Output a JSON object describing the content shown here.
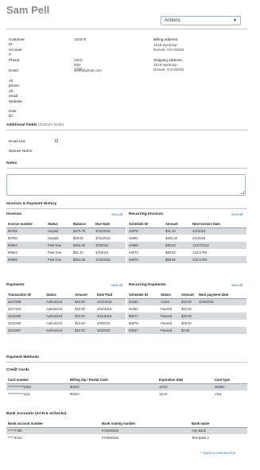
{
  "customer": {
    "name": "Sam Pell",
    "actions_label": "Actions",
    "fields": [
      {
        "label": "Customer ID:",
        "value": "150379"
      },
      {
        "label": "Account #:",
        "value": ""
      },
      {
        "label": "Phone:",
        "value": "(303) 555-1212"
      },
      {
        "label": "Email:",
        "value": "spell@gmail.com"
      },
      {
        "label": "Alt phone:",
        "value": ""
      },
      {
        "label": "Alt email:",
        "value": ""
      },
      {
        "label": "Website:",
        "value": ""
      },
      {
        "label": "User ID:",
        "value": ""
      }
    ],
    "billing": {
      "label": "Billing address:",
      "line1": "1515 wynkoop",
      "line2": "Denver, CO 80202"
    },
    "shipping": {
      "label": "Shipping address:",
      "line1": "1515 wynkoop",
      "line2": "Denver, CO 80202"
    }
  },
  "additional": {
    "title": "Additional Fields",
    "subtitle": "(Custom fields)",
    "fields": [
      {
        "label": "Email List:"
      },
      {
        "label": "Spouse Name:"
      }
    ]
  },
  "notes": {
    "title": "Notes"
  },
  "history": {
    "title": "Invoices & Payment History",
    "view_all": "view all",
    "invoices": {
      "title": "Invoices",
      "columns": [
        "Invoice number",
        "Status",
        "Balance",
        "Due Date"
      ],
      "rows": [
        [
          "89758",
          "Unpaid",
          "$273.78",
          "3/31/2015"
        ],
        [
          "89759",
          "Unpaid",
          "$25.00",
          "3/31/2015"
        ],
        [
          "89663",
          "Past Due",
          "$304.20",
          "3/3/2015"
        ],
        [
          "89664",
          "Past Due",
          "$51.20",
          "3/3/2015"
        ],
        [
          "89565",
          "Past Due",
          "$304.62",
          "1/31/2015"
        ]
      ]
    },
    "recurring_invoices": {
      "title": "Recurring Invoices",
      "columns": [
        "Schedule ID",
        "Amount",
        "Next Invoice Date"
      ],
      "rows": [
        [
          "44978",
          "$31.20",
          "4/1/2015"
        ],
        [
          "44991",
          "$304.20",
          "4/1/2015"
        ],
        [
          "44966",
          "$30.00",
          "11/27/2012"
        ],
        [
          "44973",
          "$88.62",
          "1/11/1753"
        ],
        [
          "44976",
          "$88.62",
          "1/11/1753"
        ]
      ]
    },
    "payments": {
      "title": "Payments",
      "columns": [
        "Transaction ID",
        "Status",
        "Amount",
        "Date Paid"
      ],
      "rows": [
        [
          "3217599",
          "Authorized",
          "$10.00",
          "3/12/2015"
        ],
        [
          "3217224",
          "Authorized",
          "$10.00",
          "3/11/2015"
        ],
        [
          "3216250",
          "Authorized",
          "$10.00",
          "3/11/2015"
        ],
        [
          "3215330",
          "Authorized",
          "$10.00",
          "3/9/2015"
        ],
        [
          "3214897",
          "Authorized",
          "$10.00",
          "3/6/2015"
        ]
      ]
    },
    "recurring_payments": {
      "title": "Recurring Payments",
      "columns": [
        "Schedule ID",
        "Status",
        "Amount",
        "Next payment date"
      ],
      "rows": [
        [
          "50290",
          "Active",
          "$10.00",
          "3/15/2015"
        ],
        [
          "92381",
          "Paused",
          "$10.00",
          ""
        ],
        [
          "85977",
          "Paused",
          "$25.00",
          ""
        ],
        [
          "85978",
          "Paused",
          "$25.00",
          ""
        ],
        [
          "83637",
          "Paused",
          "$3.50",
          ""
        ]
      ]
    }
  },
  "payment_methods": {
    "title": "Payment Methods",
    "credit_cards": {
      "title": "Credit Cards",
      "columns": [
        "Card number",
        "Billing Zip / Postal Code",
        "Expiration date",
        "Card type"
      ],
      "rows": [
        [
          "************5454",
          "80202",
          "12/13",
          "Master"
        ],
        [
          "************1111",
          "80202",
          "12/13",
          "Visa"
        ]
      ]
    },
    "bank_accounts": {
      "title": "Bank Accounts (ACH & eChecks)",
      "columns": [
        "Bank account number",
        "Bank routing number",
        "Bank name"
      ],
      "rows": [
        [
          "*****7788",
          "072000326",
          "Any Bank"
        ],
        [
          "*****4444",
          "072000326",
          "Test Bank 2"
        ]
      ]
    }
  },
  "back_link": "< back to customer list"
}
